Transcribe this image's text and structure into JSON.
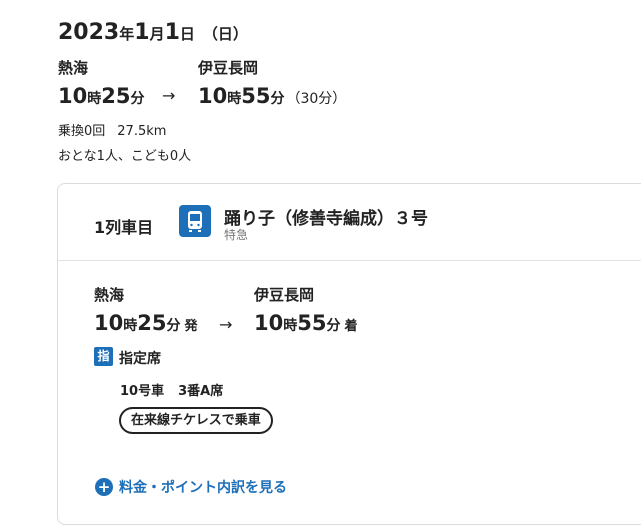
{
  "date": {
    "year": "2023",
    "year_unit": "年",
    "month": "1",
    "month_unit": "月",
    "day": "1",
    "day_unit": "日",
    "weekday": "（日）"
  },
  "route": {
    "departure_station": "熱海",
    "arrival_station": "伊豆長岡",
    "dep_hour": "10",
    "hour_unit": "時",
    "dep_min": "25",
    "min_unit": "分",
    "arrow": "→",
    "arr_hour": "10",
    "arr_min": "55",
    "duration": "（30分）",
    "transfers": "乗換0回",
    "distance": "27.5km",
    "passengers": "おとな1人、こども0人"
  },
  "card": {
    "train_number_label": "1列車目",
    "train_icon": "train-icon",
    "train_name": "踊り子（修善寺編成）３号",
    "train_type": "特急",
    "segment": {
      "dep_station": "熱海",
      "arr_station": "伊豆長岡",
      "dep_hour": "10",
      "dep_min": "25",
      "dep_suffix": "発",
      "arr_hour": "10",
      "arr_min": "55",
      "arr_suffix": "着",
      "arrow": "→"
    },
    "reserved_badge": "指",
    "reserved_label": "指定席",
    "car": "10号車",
    "seat": "3番A席",
    "ticketless_button": "在来線チケレスで乗車",
    "fare_link": "料金・ポイント内訳を見る",
    "fare_icon": "plus-circle-icon"
  },
  "colors": {
    "accent": "#1d6fb8",
    "border": "#dcdcdc"
  }
}
